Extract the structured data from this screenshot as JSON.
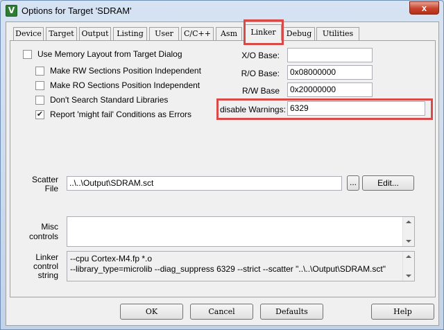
{
  "window": {
    "title": "Options for Target 'SDRAM'",
    "icon": "keil-uvision-icon",
    "close_glyph": "x"
  },
  "tabs": [
    {
      "label": "Device",
      "active": false
    },
    {
      "label": "Target",
      "active": false
    },
    {
      "label": "Output",
      "active": false
    },
    {
      "label": "Listing",
      "active": false
    },
    {
      "label": "User",
      "active": false
    },
    {
      "label": "C/C++",
      "active": false
    },
    {
      "label": "Asm",
      "active": false
    },
    {
      "label": "Linker",
      "active": true
    },
    {
      "label": "Debug",
      "active": false
    },
    {
      "label": "Utilities",
      "active": false
    }
  ],
  "options": [
    {
      "label": "Use Memory Layout from Target Dialog",
      "checked": false
    },
    {
      "label": "Make RW Sections Position Independent",
      "checked": false
    },
    {
      "label": "Make RO Sections Position Independent",
      "checked": false
    },
    {
      "label": "Don't Search Standard Libraries",
      "checked": false
    },
    {
      "label": "Report 'might fail' Conditions as Errors",
      "checked": true
    }
  ],
  "fields": {
    "xo_base": {
      "label": "X/O Base:",
      "value": ""
    },
    "ro_base": {
      "label": "R/O Base:",
      "value": "0x08000000"
    },
    "rw_base": {
      "label": "R/W Base",
      "value": "0x20000000"
    },
    "disable_warnings": {
      "label": "disable Warnings:",
      "value": "6329"
    }
  },
  "scatter": {
    "label_line1": "Scatter",
    "label_line2": "File",
    "value": "..\\..\\Output\\SDRAM.sct",
    "browse_label": "...",
    "edit_label": "Edit..."
  },
  "misc": {
    "label_line1": "Misc",
    "label_line2": "controls",
    "value": ""
  },
  "linker_string": {
    "label_line1": "Linker",
    "label_line2": "control",
    "label_line3": "string",
    "value": "--cpu Cortex-M4.fp *.o\n--library_type=microlib --diag_suppress 6329 --strict --scatter \"..\\..\\Output\\SDRAM.sct\""
  },
  "buttons": {
    "ok": "OK",
    "cancel": "Cancel",
    "defaults": "Defaults",
    "help": "Help"
  },
  "highlight_color": "#d84a4a",
  "check_glyph": "✔"
}
